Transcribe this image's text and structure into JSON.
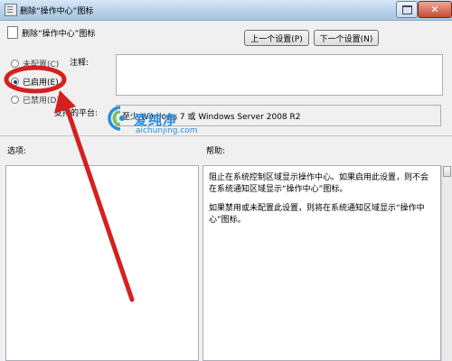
{
  "window": {
    "title": "删除“操作中心”图标",
    "close_glyph": "✕"
  },
  "policy": {
    "name": "删除“操作中心”图标"
  },
  "nav": {
    "prev_label": "上一个设置(P)",
    "next_label": "下一个设置(N)"
  },
  "state": {
    "options": [
      {
        "label": "未配置(C)",
        "checked": false
      },
      {
        "label": "已启用(E)",
        "checked": true
      },
      {
        "label": "已禁用(D)",
        "checked": false
      }
    ]
  },
  "fields": {
    "comment_label": "注释:",
    "comment_value": "",
    "platform_label": "支持的平台:",
    "platform_value": "至少 Windows 7 或 Windows Server 2008 R2"
  },
  "sections": {
    "options_label": "选项:",
    "help_label": "帮助:"
  },
  "help": {
    "paragraphs": [
      "阻止在系统控制区域显示操作中心。如果启用此设置，则不会在系统通知区域显示“操作中心”图标。",
      "如果禁用或未配置此设置，则将在系统通知区域显示“操作中心”图标。"
    ]
  },
  "watermark": {
    "cn_text": "爱纯净",
    "en_text": "aichunjing.com"
  },
  "annotation": {
    "color": "#d42020"
  }
}
